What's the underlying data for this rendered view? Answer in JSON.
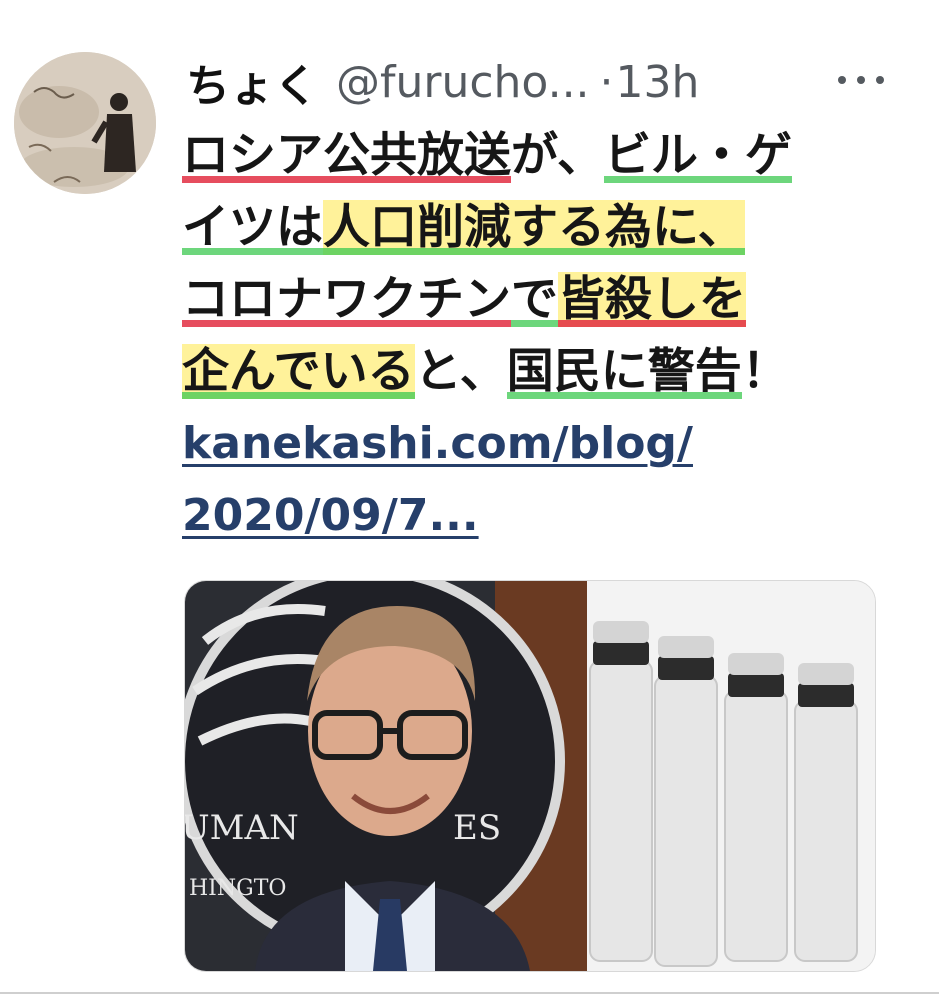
{
  "tweet": {
    "display_name": "ちょく",
    "handle": "@furucho...",
    "dot": "·",
    "time": "13h",
    "more_icon": "more-horizontal-icon",
    "text": {
      "l1_a": "ロシア公共放送",
      "l1_b": "が、",
      "l1_c": "ビル・ゲ",
      "l2_a": "イツは",
      "l2_b": "人口削減する為に、",
      "l3_a": "コロナワクチン",
      "l3_b": "で",
      "l3_c": "皆殺しを",
      "l4_a": "企んでいる",
      "l4_b": "と、",
      "l4_c": "国民に警告",
      "l4_d": "！"
    },
    "link_line1": "kanekashi.com/blog/",
    "link_line2": "2020/09/7...",
    "image_text_1": "UMAN",
    "image_text_2": "ES",
    "image_text_3": "HINGTO"
  },
  "colors": {
    "highlight_yellow": "#ffee78",
    "underline_red": "#e22e42",
    "underline_green": "#3cc850",
    "link": "#263f6a"
  }
}
